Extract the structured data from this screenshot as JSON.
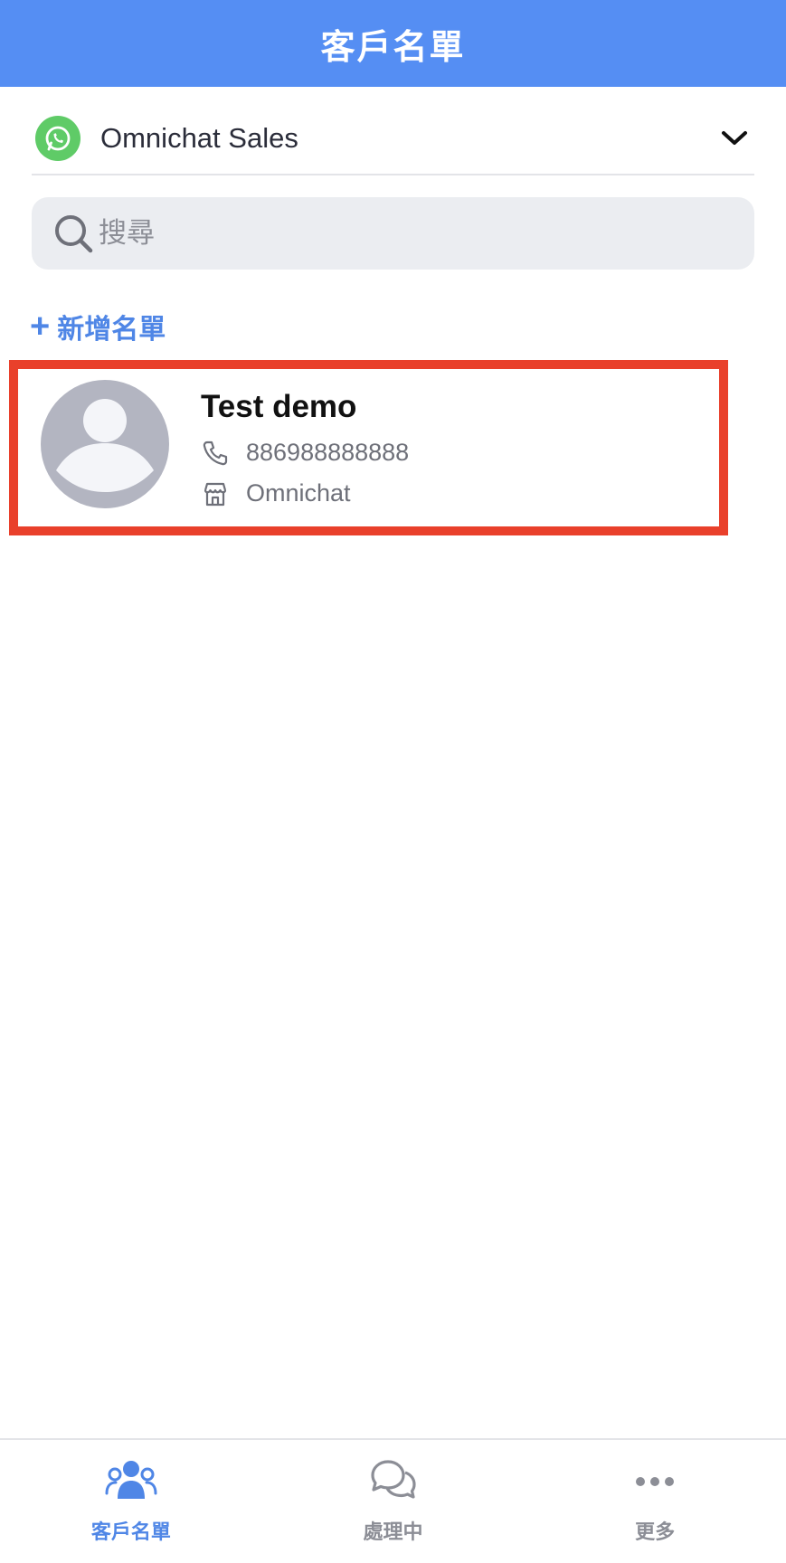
{
  "header": {
    "title": "客戶名單"
  },
  "channel": {
    "name": "Omnichat Sales",
    "icon": "whatsapp-icon",
    "brand_color": "#5fcb67"
  },
  "search": {
    "placeholder": "搜尋",
    "value": ""
  },
  "add_list": {
    "label": "新增名單",
    "icon": "plus-icon"
  },
  "contacts": [
    {
      "name": "Test demo",
      "phone": "886988888888",
      "store": "Omnichat",
      "highlight_color": "#e9402b"
    }
  ],
  "bottom_nav": [
    {
      "label": "客戶名單",
      "icon": "people-icon",
      "active": true
    },
    {
      "label": "處理中",
      "icon": "chat-bubbles-icon",
      "active": false
    },
    {
      "label": "更多",
      "icon": "more-dots-icon",
      "active": false
    }
  ],
  "colors": {
    "primary": "#558ef3",
    "accent": "#4f86e6",
    "muted": "#8c8e96"
  }
}
